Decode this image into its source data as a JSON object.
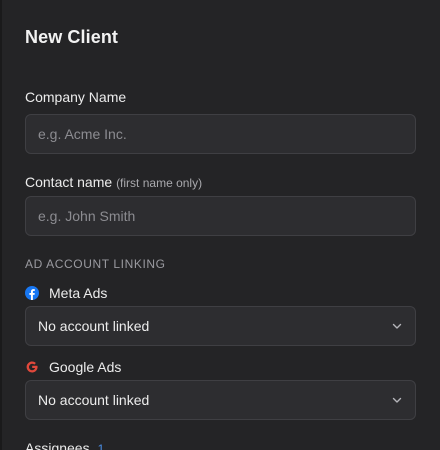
{
  "dialog": {
    "title": "New Client"
  },
  "company": {
    "label": "Company Name",
    "placeholder": "e.g. Acme Inc."
  },
  "contact": {
    "label": "Contact name",
    "hint": "(first name only)",
    "placeholder": "e.g. John Smith"
  },
  "ad_linking": {
    "section_label": "AD ACCOUNT LINKING",
    "meta": {
      "label": "Meta Ads",
      "icon": "meta-icon",
      "icon_color": "#1877f2",
      "selected": "No account linked"
    },
    "google": {
      "label": "Google Ads",
      "icon": "google-icon",
      "icon_color": "#e0483b",
      "selected": "No account linked"
    }
  },
  "assignees": {
    "label": "Assignees",
    "count": "1",
    "count_color": "#4a8fe7"
  }
}
